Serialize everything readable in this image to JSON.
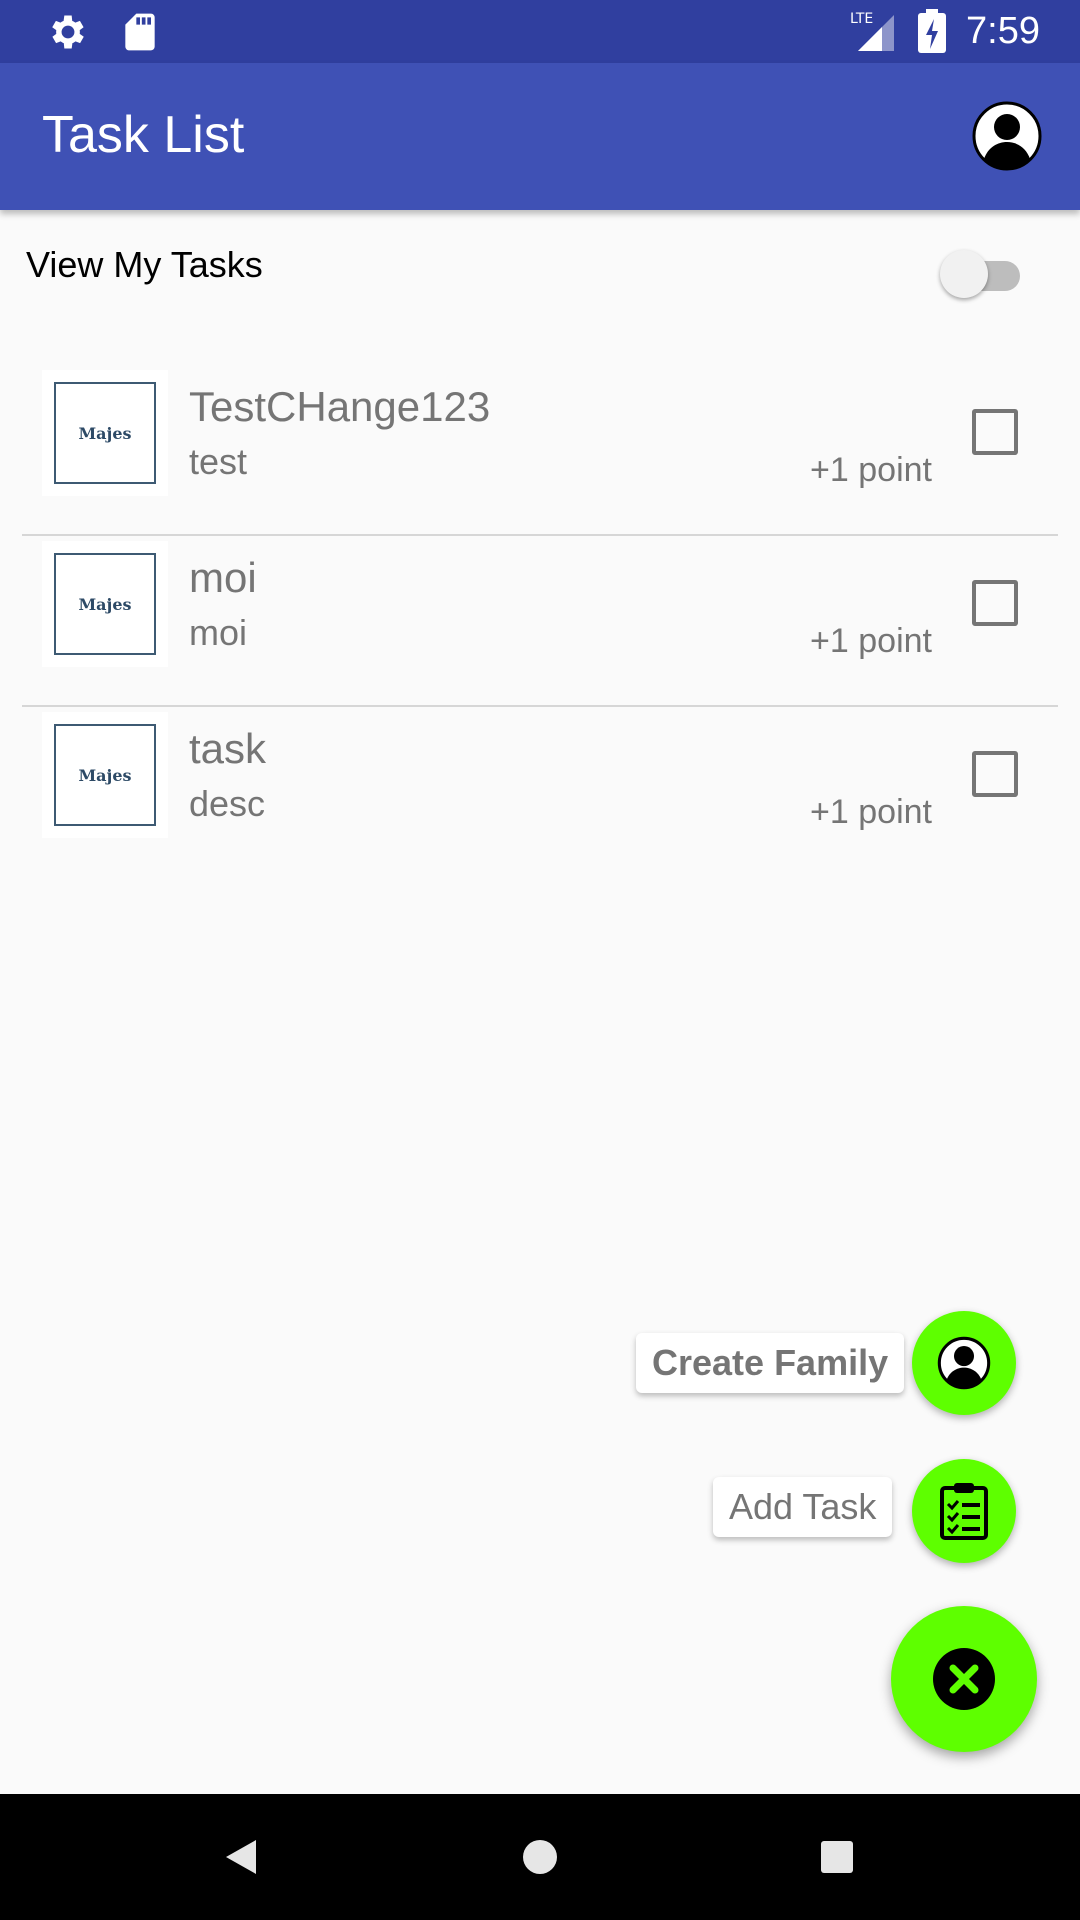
{
  "status_bar": {
    "time": "7:59",
    "network_label": "LTE",
    "icons": [
      "settings-icon",
      "sd-card-icon",
      "signal-icon",
      "battery-charging-icon"
    ]
  },
  "app_bar": {
    "title": "Task List",
    "profile_icon": "account-circle-icon"
  },
  "filter": {
    "label": "View My Tasks",
    "enabled": false
  },
  "tasks": [
    {
      "title": "TestCHange123",
      "description": "test",
      "points": "+1 point",
      "image_text": "Majes",
      "checked": false
    },
    {
      "title": "moi",
      "description": "moi",
      "points": "+1 point",
      "image_text": "Majes",
      "checked": false
    },
    {
      "title": "task",
      "description": "desc",
      "points": "+1 point",
      "image_text": "Majes",
      "checked": false
    }
  ],
  "fab_menu": {
    "create_family_label": "Create Family",
    "add_task_label": "Add Task",
    "close_icon": "close-icon",
    "accent_color": "#5eff00"
  },
  "colors": {
    "status_bar": "#303f9f",
    "app_bar": "#3f51b5",
    "fab": "#5eff00"
  },
  "nav_bar": {
    "icons": [
      "back-icon",
      "home-icon",
      "recents-icon"
    ]
  }
}
